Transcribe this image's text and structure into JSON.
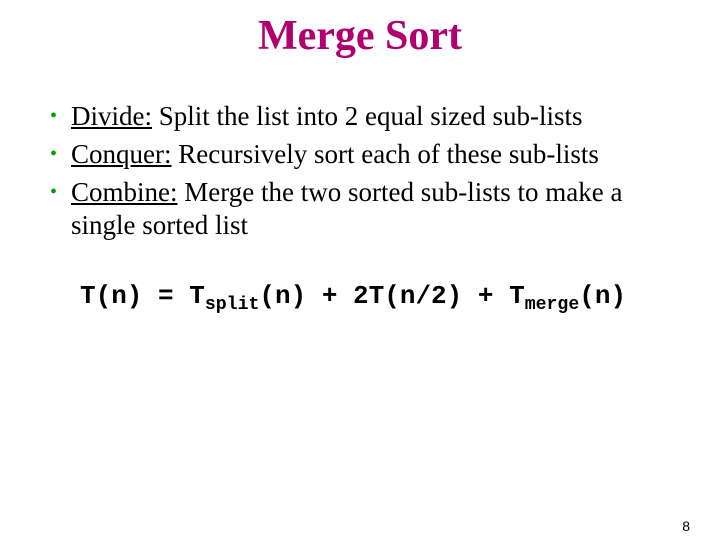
{
  "title": "Merge Sort",
  "bullets": [
    {
      "label": "Divide:",
      "text": " Split the list into 2 equal sized sub-lists"
    },
    {
      "label": "Conquer:",
      "text": " Recursively sort each of these sub-lists"
    },
    {
      "label": "Combine:",
      "text": " Merge the two sorted sub-lists to make a single sorted list"
    }
  ],
  "equation": {
    "lhs": "T(n)",
    "eq": "  =  ",
    "term1_base": "T",
    "term1_sub": "split",
    "term1_arg": "(n)",
    "plus1": "  +  ",
    "term2": "2T(n/2)",
    "plus2": "  +  ",
    "term3_base": "T",
    "term3_sub": "merge",
    "term3_arg": "(n)"
  },
  "page_number": "8"
}
